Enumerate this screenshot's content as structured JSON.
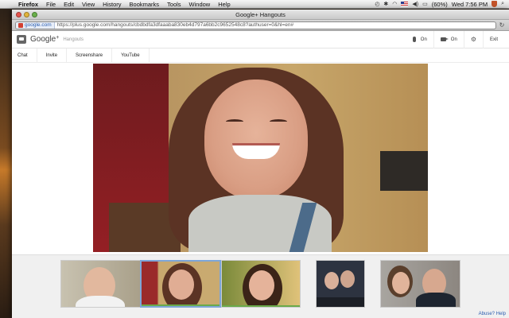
{
  "menubar": {
    "app_name": "Firefox",
    "items": [
      "File",
      "Edit",
      "View",
      "History",
      "Bookmarks",
      "Tools",
      "Window",
      "Help"
    ],
    "battery": "(60%)",
    "clock": "Wed 7:56 PM"
  },
  "window": {
    "title": "Google+ Hangouts",
    "site_badge": "google.com",
    "url": "https://plus.google.com/hangouts/cbdbdfa3dfaaaba830eb4d797a6bb2c9652548c8?authuser=0&hl=en#"
  },
  "app": {
    "brand": "Google",
    "brand_plus": "+",
    "brand_sub": "Hangouts",
    "mic_label": "On",
    "camera_label": "On",
    "exit_label": "Exit",
    "toolbar": [
      "Chat",
      "Invite",
      "Screenshare",
      "YouTube"
    ]
  },
  "footer": {
    "abuse_link": "Abuse? Help"
  },
  "thumbnails": {
    "selected_index": 1,
    "count": 5
  }
}
